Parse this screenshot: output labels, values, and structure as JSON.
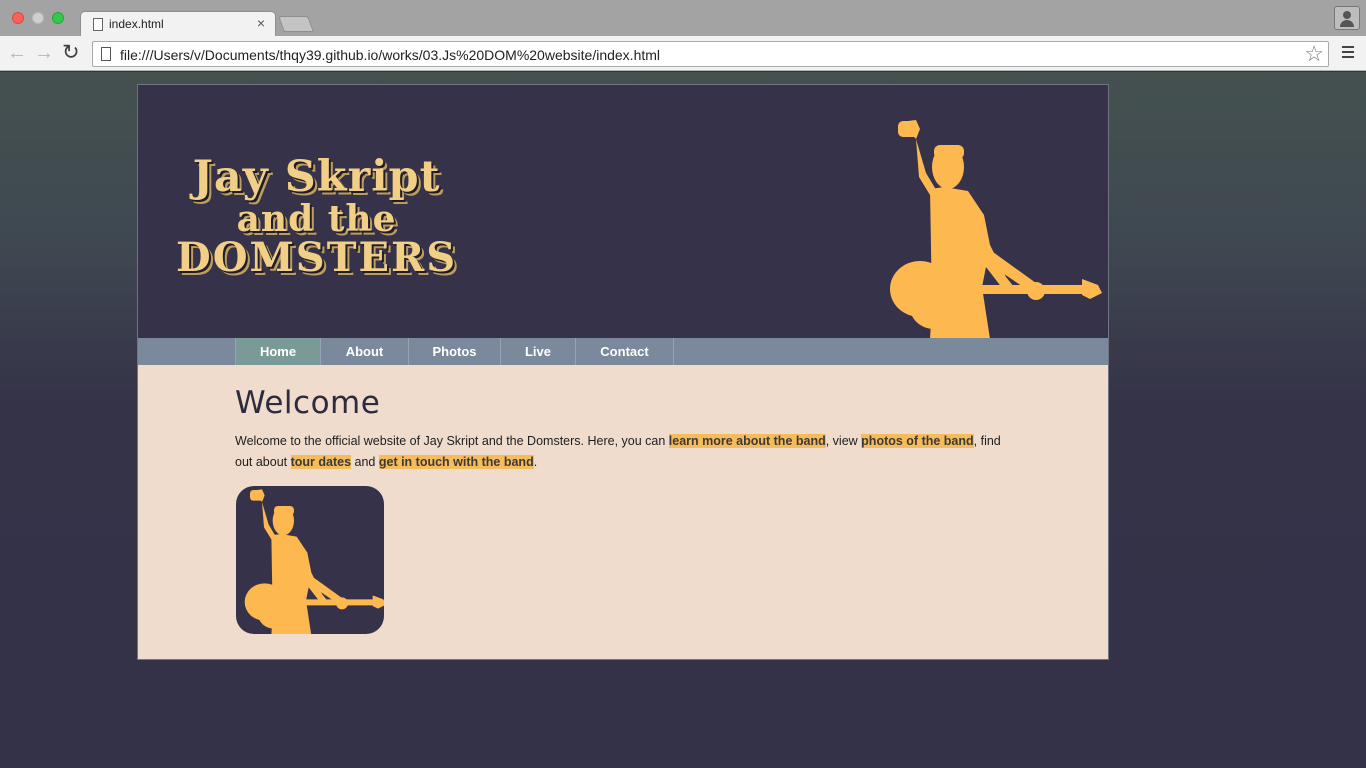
{
  "browser": {
    "tab_title": "index.html",
    "tab_close_icon": "close-icon",
    "url": "file:///Users/v/Documents/thqy39.github.io/works/03.Js%20DOM%20website/index.html",
    "icons": {
      "back": "arrow-left-icon",
      "forward": "arrow-right-icon",
      "reload": "reload-icon",
      "bookmark": "star-icon",
      "menu": "hamburger-menu-icon",
      "profile": "user-icon"
    }
  },
  "site": {
    "logo": {
      "line1": "Jay Skript",
      "line2": "and the",
      "line3": "DOMSTERS"
    },
    "nav": [
      {
        "label": "Home",
        "active": true
      },
      {
        "label": "About",
        "active": false
      },
      {
        "label": "Photos",
        "active": false
      },
      {
        "label": "Live",
        "active": false
      },
      {
        "label": "Contact",
        "active": false
      }
    ],
    "content": {
      "title": "Welcome",
      "intro_1": "Welcome to the official website of Jay Skript and the Domsters. Here, you can ",
      "link_about": "learn more about the band",
      "intro_2": ", view ",
      "link_photos": "photos of the band",
      "intro_3": ", find out about ",
      "link_live": "tour dates",
      "intro_4": " and ",
      "link_contact": "get in touch with the band",
      "intro_5": "."
    },
    "colors": {
      "header_bg": "#353249",
      "accent": "#f6bb5a",
      "nav_bg": "#7a899c",
      "nav_active": "#7a9a98",
      "content_bg": "#efdccc"
    }
  }
}
